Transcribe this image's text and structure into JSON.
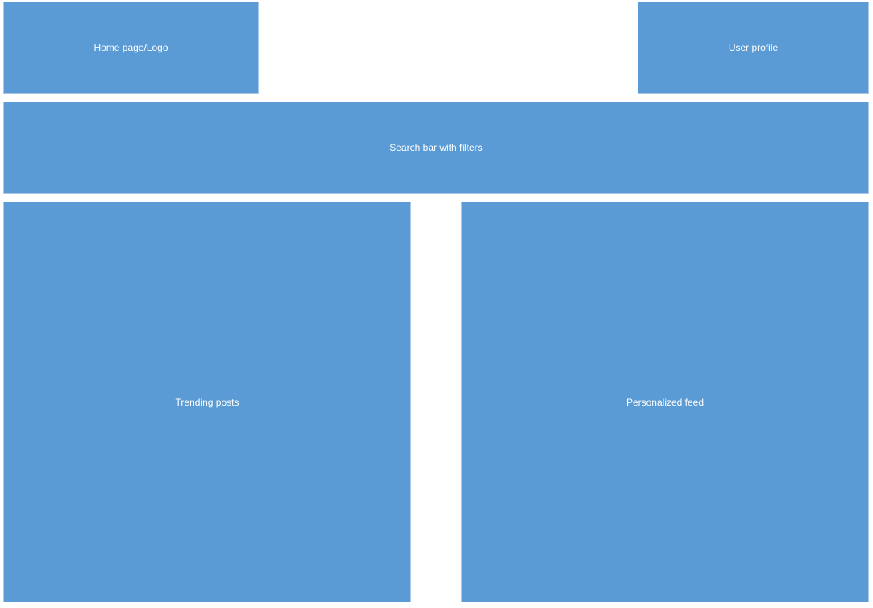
{
  "header": {
    "logo_label": "Home page/Logo",
    "profile_label": "User profile"
  },
  "search": {
    "label": "Search bar with filters"
  },
  "content": {
    "trending_label": "Trending posts",
    "feed_label": "Personalized feed"
  },
  "colors": {
    "block_fill": "#5b9bd5",
    "block_text": "#ffffff",
    "background": "#ffffff"
  }
}
